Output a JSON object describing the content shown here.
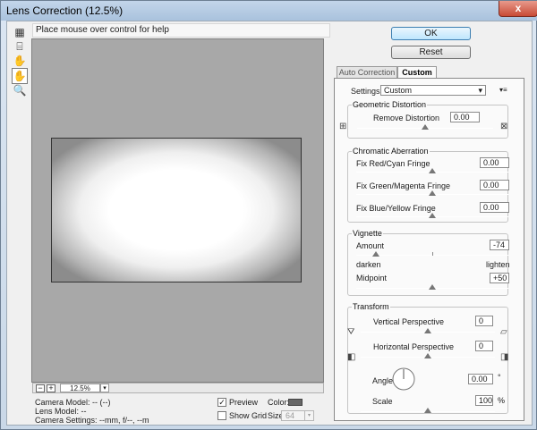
{
  "window": {
    "title": "Lens Correction (12.5%)",
    "close_glyph": "x"
  },
  "toolbar": {
    "tools": [
      {
        "name": "remove-distortion-tool-icon",
        "glyph": "▦",
        "selected": false
      },
      {
        "name": "straighten-tool-icon",
        "glyph": "⌸",
        "selected": false
      },
      {
        "name": "move-grid-tool-icon",
        "glyph": "✋",
        "selected": false
      },
      {
        "name": "hand-tool-icon",
        "glyph": "✋",
        "selected": true
      },
      {
        "name": "zoom-tool-icon",
        "glyph": "🔍",
        "selected": false
      }
    ]
  },
  "help_text": "Place mouse over control for help",
  "zoom": {
    "minus": "−",
    "plus": "+",
    "value": "12.5%",
    "dropdown_glyph": "▾"
  },
  "camera_info": {
    "model": "Camera Model: -- (--)",
    "lens": "Lens Model: --",
    "settings": "Camera Settings: --mm, f/--, --m"
  },
  "preview": {
    "label": "Preview",
    "checked": true,
    "check_glyph": "✓"
  },
  "show_grid": {
    "label": "Show Grid",
    "checked": false
  },
  "grid_color": {
    "label": "Color:",
    "value": "#666666"
  },
  "grid_size": {
    "label": "Size:",
    "value": "64",
    "dropdown_glyph": "▾"
  },
  "buttons": {
    "ok": "OK",
    "reset": "Reset"
  },
  "tabs": [
    {
      "label": "Auto Correction",
      "active": false
    },
    {
      "label": "Custom",
      "active": true
    }
  ],
  "settings": {
    "label": "Settings:",
    "value": "Custom",
    "dropdown_glyph": "▾",
    "menu_glyph": "▾≡"
  },
  "geometric_distortion": {
    "title": "Geometric Distortion",
    "remove_distortion": {
      "label": "Remove Distortion",
      "value": "0.00",
      "fraction": 0.5,
      "icon_left": "⊞",
      "icon_right": "⊠"
    }
  },
  "chromatic_aberration": {
    "title": "Chromatic Aberration",
    "red_cyan": {
      "label": "Fix Red/Cyan Fringe",
      "value": "0.00",
      "fraction": 0.5
    },
    "green_magenta": {
      "label": "Fix Green/Magenta Fringe",
      "value": "0.00",
      "fraction": 0.5
    },
    "blue_yellow": {
      "label": "Fix Blue/Yellow Fringe",
      "value": "0.00",
      "fraction": 0.5
    }
  },
  "vignette": {
    "title": "Vignette",
    "amount": {
      "label": "Amount",
      "value": "-74",
      "fraction": 0.13
    },
    "darken": "darken",
    "lighten": "lighten",
    "midpoint": {
      "label": "Midpoint",
      "value": "+50",
      "fraction": 0.5
    }
  },
  "transform": {
    "title": "Transform",
    "vertical": {
      "label": "Vertical Perspective",
      "value": "0",
      "fraction": 0.5,
      "icon_left": "⛛",
      "icon_right": "▱"
    },
    "horizontal": {
      "label": "Horizontal Perspective",
      "value": "0",
      "fraction": 0.5,
      "icon_left": "◧",
      "icon_right": "◨"
    },
    "angle": {
      "label": "Angle:",
      "value": "0.00",
      "unit": "°"
    },
    "scale": {
      "label": "Scale",
      "value": "100",
      "unit": "%",
      "fraction": 0.5
    }
  }
}
